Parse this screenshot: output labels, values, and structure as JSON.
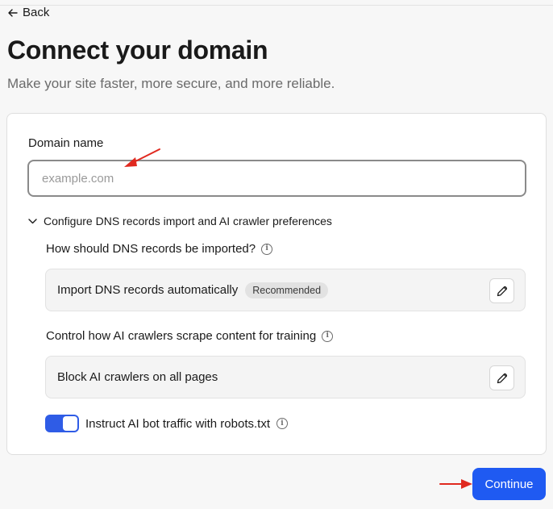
{
  "nav": {
    "back_label": "Back"
  },
  "header": {
    "title": "Connect your domain",
    "subtitle": "Make your site faster, more secure, and more reliable."
  },
  "form": {
    "domain_label": "Domain name",
    "domain_placeholder": "example.com",
    "domain_value": "",
    "dns_toggle_label": "Configure DNS records import and AI crawler preferences",
    "dns_toggle_expanded": true,
    "dns_question": "How should DNS records be imported?",
    "dns_option": "Import DNS records automatically",
    "dns_badge": "Recommended",
    "crawler_question": "Control how AI crawlers scrape content for training",
    "crawler_option": "Block AI crawlers on all pages",
    "robots_label": "Instruct AI bot traffic with robots.txt",
    "robots_enabled": true
  },
  "actions": {
    "continue_label": "Continue"
  },
  "colors": {
    "primary": "#1f5af2",
    "switch_on": "#2f5ce6",
    "annotation_arrow": "#e0291f"
  },
  "icons": [
    "back-arrow-icon",
    "chevron-down-icon",
    "info-icon",
    "pencil-icon"
  ]
}
